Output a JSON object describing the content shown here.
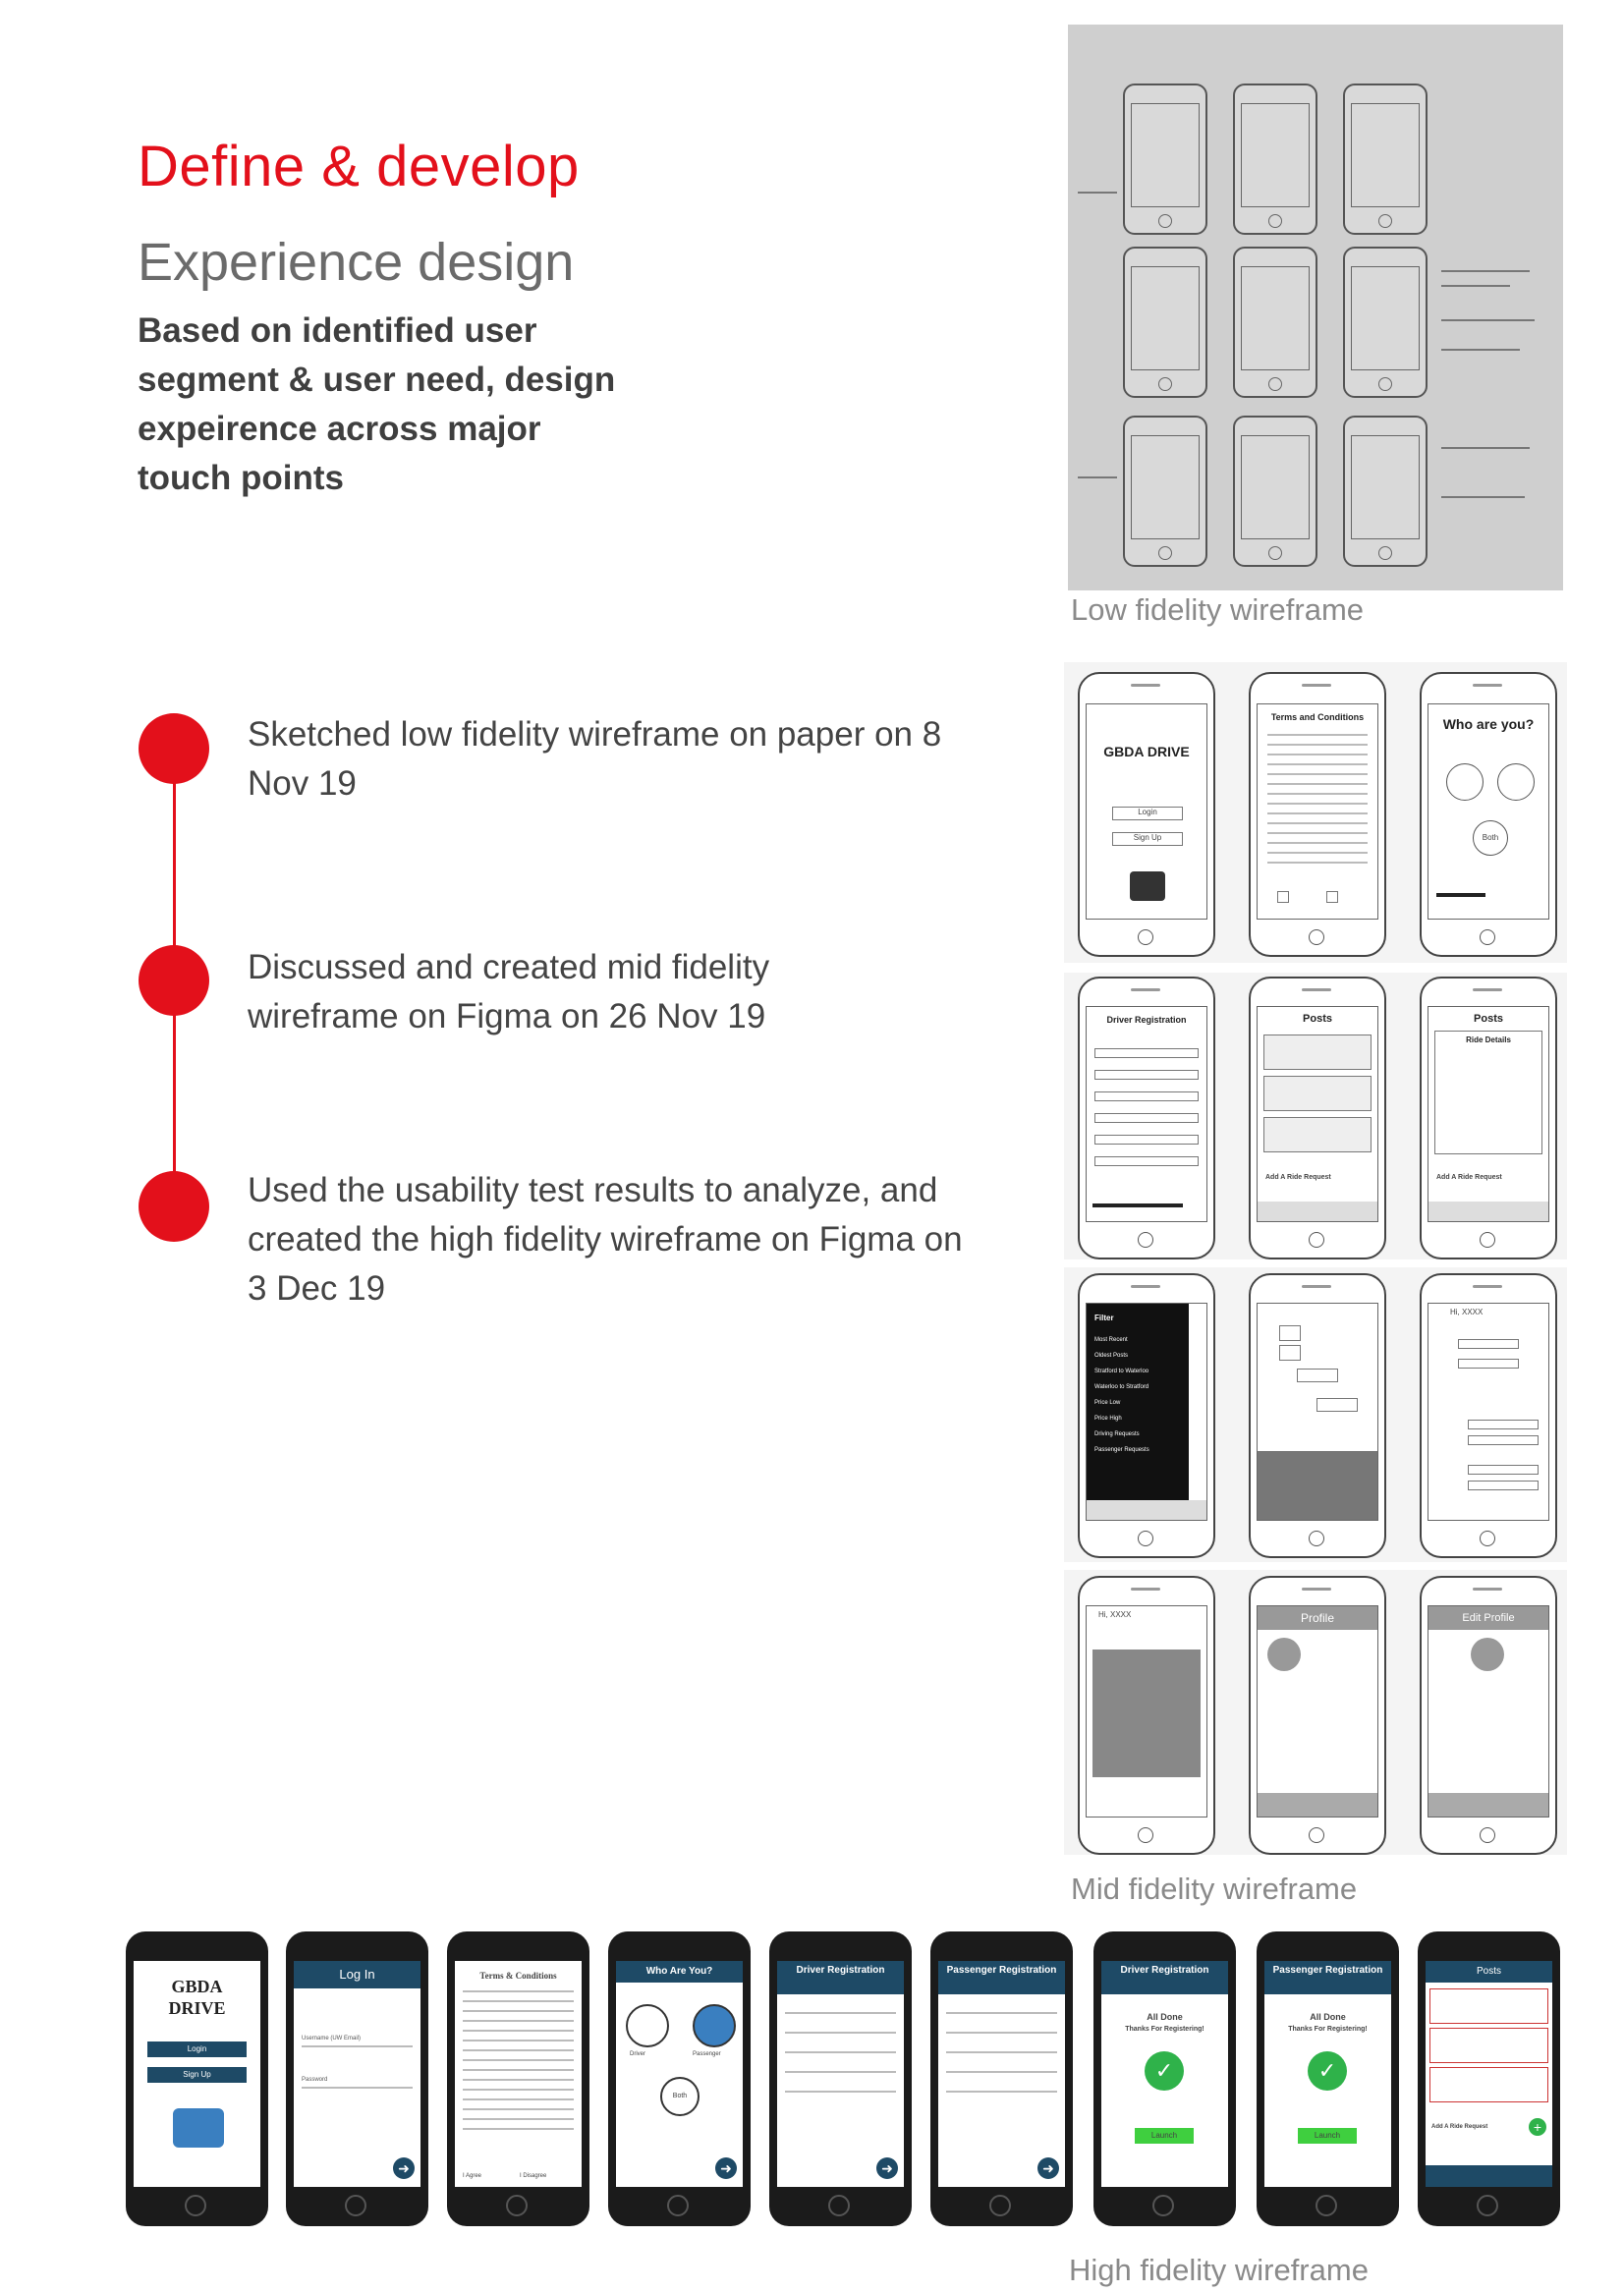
{
  "heading": {
    "title": "Define & develop",
    "subtitle": "Experience design",
    "summary": "Based on identified user segment & user need, design expeirence across major touch points"
  },
  "timeline": [
    {
      "text": "Sketched low fidelity wireframe on paper on 8 Nov 19"
    },
    {
      "text": "Discussed and created mid fidelity wireframe on Figma on 26 Nov 19"
    },
    {
      "text": "Used the usability test results to analyze, and created the high fidelity wireframe on Figma on 3 Dec 19"
    }
  ],
  "captions": {
    "lowfi": "Low fidelity wireframe",
    "midfi": "Mid fidelity wireframe",
    "hifi": "High fidelity wireframe"
  },
  "midfi": {
    "gbda_drive": "GBDA DRIVE",
    "login": "Login",
    "signup": "Sign Up",
    "terms": "Terms and Conditions",
    "who_are_you": "Who are you?",
    "both": "Both",
    "driver_registration": "Driver Registration",
    "posts": "Posts",
    "ride_details": "Ride Details",
    "add_ride_request": "Add A Ride Request",
    "filter": "Filter",
    "filter_items": [
      "Most Recent",
      "Oldest Posts",
      "Stratford to Waterloo",
      "Waterloo to Stratford",
      "Price Low",
      "Price High",
      "Driving Requests",
      "Passenger Requests"
    ],
    "hi_xxx": "Hi, XXXX",
    "profile": "Profile",
    "edit_profile": "Edit Profile"
  },
  "hifi": {
    "gbda_line1": "GBDA",
    "gbda_line2": "DRIVE",
    "login": "Login",
    "signup": "Sign Up",
    "log_in_title": "Log In",
    "username": "Username (UW Email)",
    "password": "Password",
    "terms": "Terms & Conditions",
    "agree": "I Agree",
    "disagree": "I Disagree",
    "who_are_you": "Who Are You?",
    "driver": "Driver",
    "passenger": "Passenger",
    "both": "Both",
    "driver_reg": "Driver Registration",
    "passenger_reg": "Passenger Registration",
    "all_done": "All Done",
    "thanks": "Thanks For Registering!",
    "launch": "Launch",
    "posts": "Posts",
    "add_ride_request": "Add A Ride Request"
  }
}
